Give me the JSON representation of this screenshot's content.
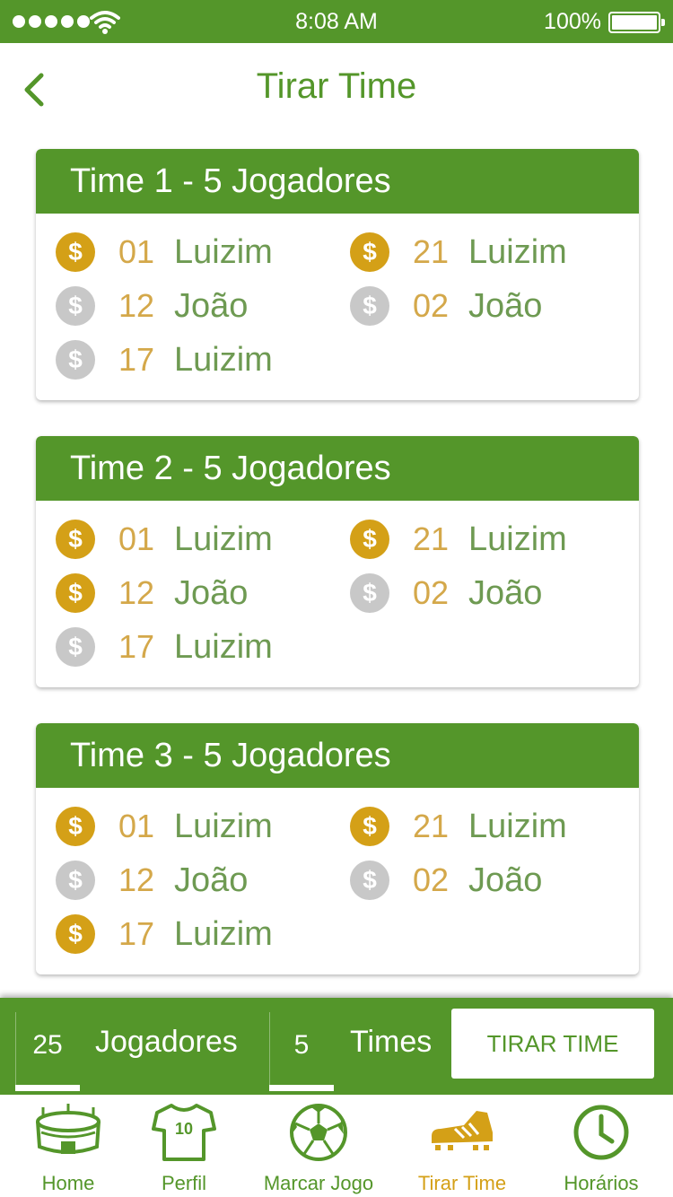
{
  "status_bar": {
    "time": "8:08 AM",
    "battery": "100%"
  },
  "header": {
    "title": "Tirar Time"
  },
  "teams": [
    {
      "title": "Time 1 - 5 Jogadores",
      "players": [
        {
          "number": "01",
          "name": "Luizim",
          "paid": true
        },
        {
          "number": "21",
          "name": "Luizim",
          "paid": true
        },
        {
          "number": "12",
          "name": "João",
          "paid": false
        },
        {
          "number": "02",
          "name": "João",
          "paid": false
        },
        {
          "number": "17",
          "name": "Luizim",
          "paid": false
        }
      ]
    },
    {
      "title": "Time 2 - 5 Jogadores",
      "players": [
        {
          "number": "01",
          "name": "Luizim",
          "paid": true
        },
        {
          "number": "21",
          "name": "Luizim",
          "paid": true
        },
        {
          "number": "12",
          "name": "João",
          "paid": true
        },
        {
          "number": "02",
          "name": "João",
          "paid": false
        },
        {
          "number": "17",
          "name": "Luizim",
          "paid": false
        }
      ]
    },
    {
      "title": "Time 3 - 5 Jogadores",
      "players": [
        {
          "number": "01",
          "name": "Luizim",
          "paid": true
        },
        {
          "number": "21",
          "name": "Luizim",
          "paid": true
        },
        {
          "number": "12",
          "name": "João",
          "paid": false
        },
        {
          "number": "02",
          "name": "João",
          "paid": false
        },
        {
          "number": "17",
          "name": "Luizim",
          "paid": true
        }
      ]
    }
  ],
  "coin_symbol": "$",
  "bottom_bar": {
    "players_count": "25",
    "players_label": "Jogadores",
    "teams_count": "5",
    "teams_label": "Times",
    "button_label": "TIRAR TIME"
  },
  "tabs": [
    {
      "label": "Home",
      "icon": "stadium-icon"
    },
    {
      "label": "Perfil",
      "icon": "jersey-icon"
    },
    {
      "label": "Marcar Jogo",
      "icon": "soccer-ball-icon"
    },
    {
      "label": "Tirar Time",
      "icon": "cleat-icon",
      "active": true
    },
    {
      "label": "Horários",
      "icon": "clock-icon"
    }
  ],
  "colors": {
    "primary": "#54962a",
    "gold": "#d4a017",
    "gray_coin": "#c8c8c8",
    "number": "#d4a84a",
    "name": "#6e9a52"
  }
}
